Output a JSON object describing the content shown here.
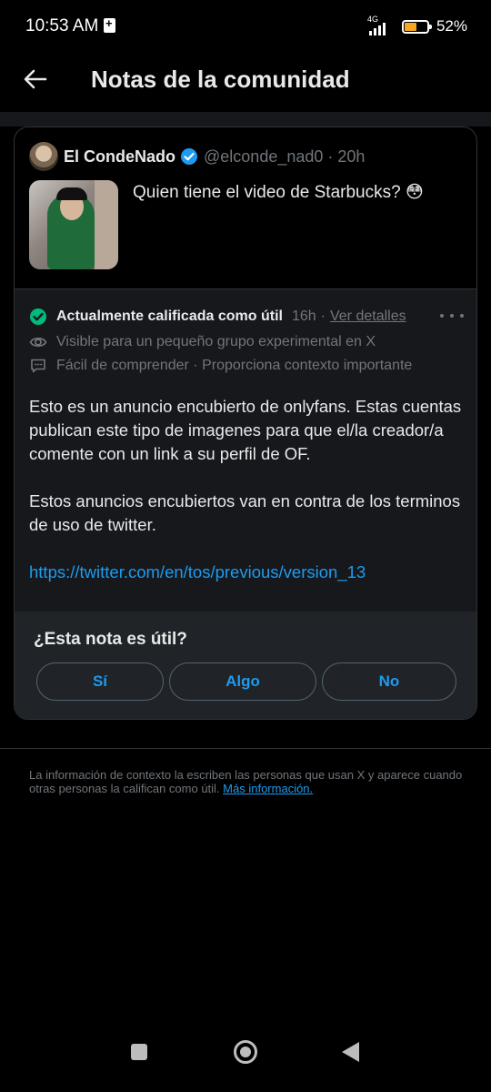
{
  "status_bar": {
    "time": "10:53 AM",
    "network": "4G",
    "battery_pct": "52%",
    "battery_level": 0.52
  },
  "header": {
    "title": "Notas de la comunidad"
  },
  "tweet": {
    "author_name": "El CondeNado",
    "handle": "@elconde_nad0 · 20h",
    "text": "Quien tiene el video de Starbucks? 😳"
  },
  "note": {
    "status_label": "Actualmente calificada como útil",
    "time": "16h",
    "separator": "·",
    "details_link": "Ver detalles",
    "visibility": "Visible para un pequeño grupo experimental en X",
    "reasons": "Fácil de comprender · Proporciona contexto importante",
    "paragraph1": "Esto es un anuncio encubierto de onlyfans. Estas cuentas publican este tipo de imagenes para que el/la creador/a comente con un link a su perfil de OF.",
    "paragraph2": "Estos anuncios encubiertos van en contra de los terminos de uso de twitter.",
    "link": "https://twitter.com/en/tos/previous/version_13"
  },
  "rating": {
    "question": "¿Esta nota es útil?",
    "yes": "Sí",
    "somewhat": "Algo",
    "no": "No"
  },
  "footer": {
    "text": "La información de contexto la escriben las personas que usan X y aparece cuando otras personas la califican como útil.",
    "link": "Más información."
  },
  "colors": {
    "accent": "#1d9bf0",
    "helpful": "#00ba7c",
    "battery": "#f5a623"
  }
}
